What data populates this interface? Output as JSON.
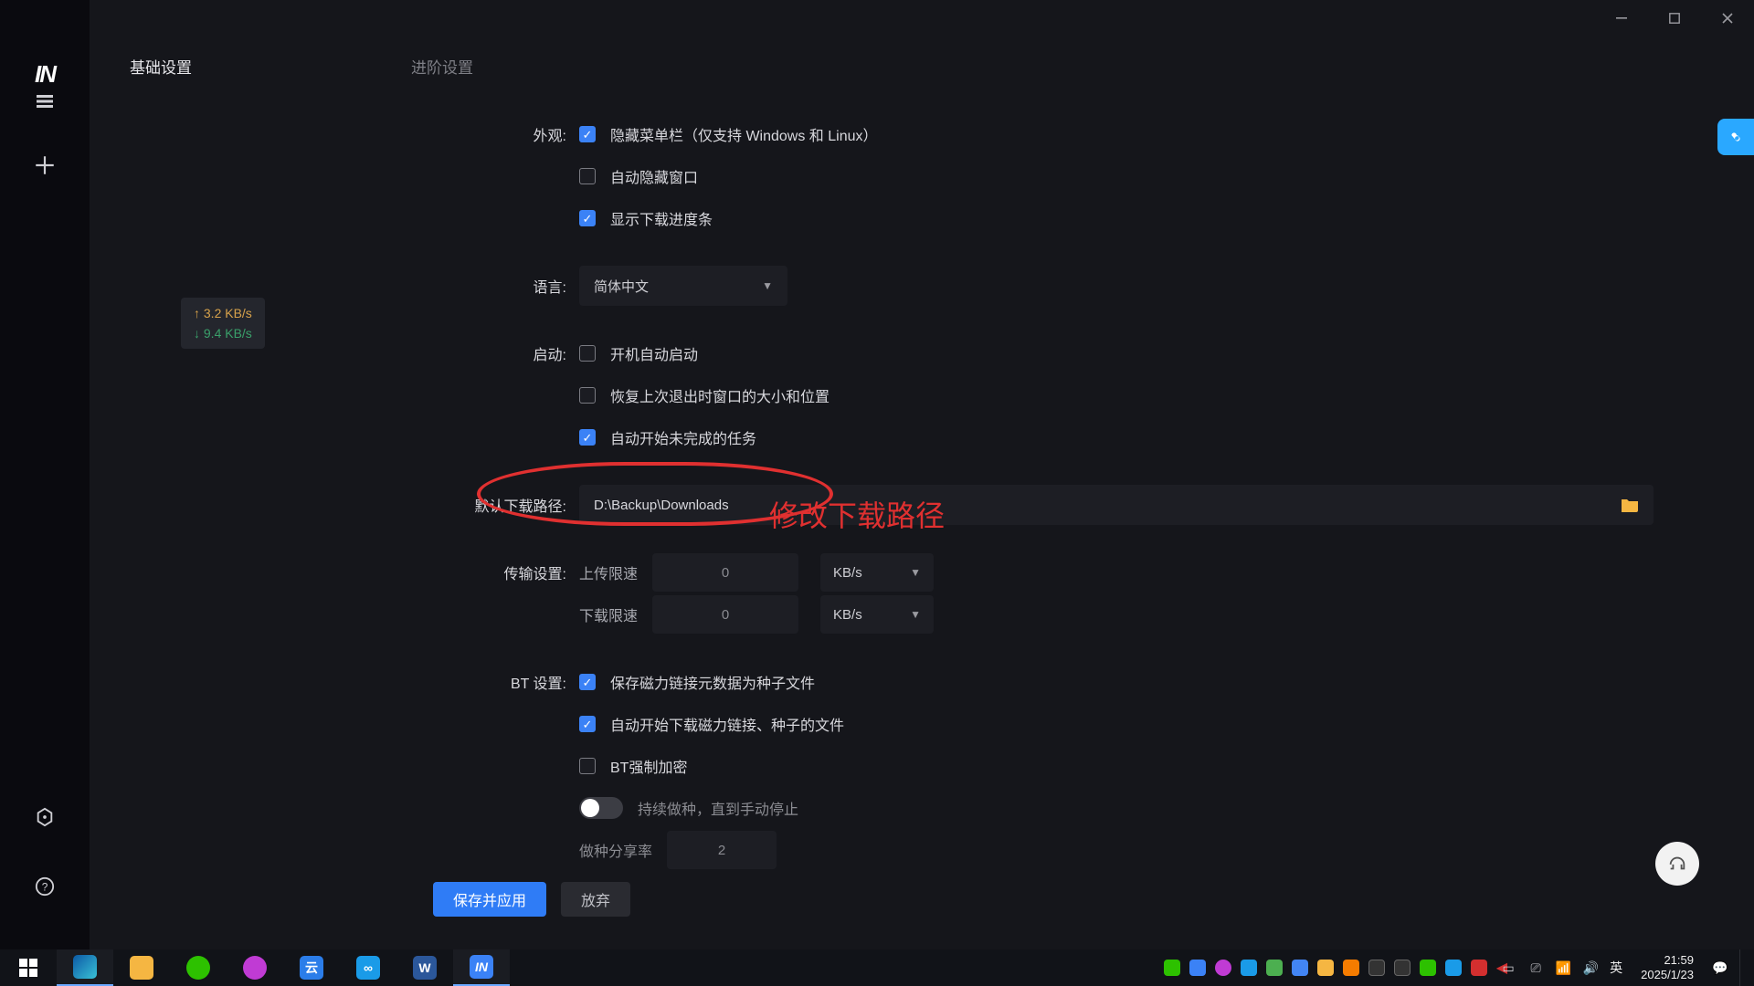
{
  "rail": {
    "logo": "IN"
  },
  "tabs": {
    "basic": "基础设置",
    "advanced": "进阶设置"
  },
  "speed": {
    "up": "↑ 3.2 KB/s",
    "down": "↓ 9.4 KB/s"
  },
  "sections": {
    "appearance": {
      "label": "外观:",
      "hide_menu": "隐藏菜单栏（仅支持 Windows 和 Linux）",
      "auto_hide_win": "自动隐藏窗口",
      "show_progress": "显示下载进度条"
    },
    "language": {
      "label": "语言:",
      "value": "简体中文"
    },
    "startup": {
      "label": "启动:",
      "autostart": "开机自动启动",
      "restore_window": "恢复上次退出时窗口的大小和位置",
      "resume_tasks": "自动开始未完成的任务"
    },
    "download_path": {
      "label": "默认下载路径:",
      "value": "D:\\Backup\\Downloads"
    },
    "transfer": {
      "label": "传输设置:",
      "upload_label": "上传限速",
      "download_label": "下载限速",
      "upload_value": "0",
      "download_value": "0",
      "unit": "KB/s"
    },
    "bt": {
      "label": "BT 设置:",
      "save_magnet": "保存磁力链接元数据为种子文件",
      "auto_download": "自动开始下载磁力链接、种子的文件",
      "force_encrypt": "BT强制加密",
      "keep_seeding": "持续做种，直到手动停止",
      "seed_ratio_label": "做种分享率",
      "seed_ratio_value": "2"
    }
  },
  "buttons": {
    "save": "保存并应用",
    "discard": "放弃"
  },
  "annotation": {
    "text": "修改下载路径"
  },
  "tray": {
    "ime": "英",
    "time": "21:59",
    "date": "2025/1/23"
  }
}
